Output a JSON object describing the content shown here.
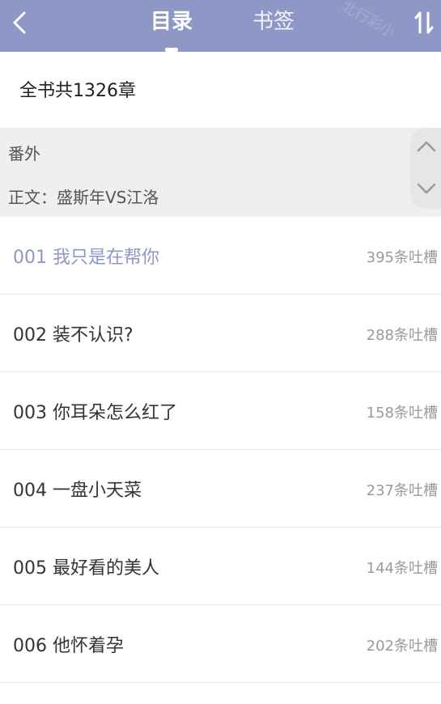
{
  "header": {
    "tabs": [
      {
        "label": "目录",
        "active": true
      },
      {
        "label": "书签",
        "active": false
      }
    ],
    "watermark": "北行彩小"
  },
  "summary": {
    "total_label": "全书共1326章"
  },
  "volumes": [
    {
      "label": "番外"
    },
    {
      "label": "正文：盛斯年VS江洛"
    }
  ],
  "chapters": [
    {
      "title": "001 我只是在帮你",
      "count": "395条吐槽",
      "current": true
    },
    {
      "title": "002 装不认识?",
      "count": "288条吐槽"
    },
    {
      "title": "003 你耳朵怎么红了",
      "count": "158条吐槽"
    },
    {
      "title": "004 一盘小天菜",
      "count": "237条吐槽"
    },
    {
      "title": "005 最好看的美人",
      "count": "144条吐槽"
    },
    {
      "title": "006  他怀着孕",
      "count": "202条吐槽"
    }
  ],
  "colors": {
    "header_bg": "#8e97c5",
    "accent": "#8e97c5",
    "panel_bg": "#efefef"
  }
}
